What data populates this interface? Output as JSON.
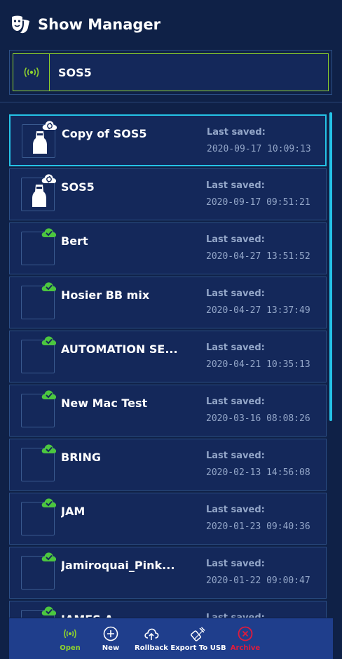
{
  "header": {
    "title": "Show Manager",
    "icon": "masks-icon"
  },
  "current_show": {
    "name": "SOS5",
    "icon": "signal-icon"
  },
  "shows": [
    {
      "name": "Copy of SOS5",
      "saved_label": "Last saved:",
      "saved_date": "2020-09-17 10:09:13",
      "thumb": "bag",
      "badge": "cloud-sync",
      "selected": true
    },
    {
      "name": "SOS5",
      "saved_label": "Last saved:",
      "saved_date": "2020-09-17 09:51:21",
      "thumb": "bag",
      "badge": "cloud-sync",
      "selected": false
    },
    {
      "name": "Bert",
      "saved_label": "Last saved:",
      "saved_date": "2020-04-27 13:51:52",
      "thumb": "empty",
      "badge": "cloud-check",
      "selected": false
    },
    {
      "name": "Hosier BB mix",
      "saved_label": "Last saved:",
      "saved_date": "2020-04-27 13:37:49",
      "thumb": "empty",
      "badge": "cloud-check",
      "selected": false
    },
    {
      "name": "AUTOMATION SE...",
      "saved_label": "Last saved:",
      "saved_date": "2020-04-21 10:35:13",
      "thumb": "empty",
      "badge": "cloud-check",
      "selected": false
    },
    {
      "name": "New Mac Test",
      "saved_label": "Last saved:",
      "saved_date": "2020-03-16 08:08:26",
      "thumb": "empty",
      "badge": "cloud-check",
      "selected": false
    },
    {
      "name": "BRING",
      "saved_label": "Last saved:",
      "saved_date": "2020-02-13 14:56:08",
      "thumb": "empty",
      "badge": "cloud-check",
      "selected": false
    },
    {
      "name": "JAM",
      "saved_label": "Last saved:",
      "saved_date": "2020-01-23 09:40:36",
      "thumb": "empty",
      "badge": "cloud-check",
      "selected": false
    },
    {
      "name": "Jamiroquai_Pink...",
      "saved_label": "Last saved:",
      "saved_date": "2020-01-22 09:00:47",
      "thumb": "empty",
      "badge": "cloud-check",
      "selected": false
    },
    {
      "name": "JAMES A...",
      "saved_label": "Last saved:",
      "saved_date": "",
      "thumb": "empty",
      "badge": "cloud-check",
      "selected": false
    }
  ],
  "toolbar": {
    "open": "Open",
    "new": "New",
    "rollback": "Rollback",
    "export": "Export To USB",
    "archive": "Archive"
  },
  "colors": {
    "background": "#0f2147",
    "card": "#14285a",
    "card_border": "#2c4f86",
    "selected_border": "#25c3e6",
    "accent_green": "#8ed12e",
    "archive_red": "#e01b3c",
    "toolbar": "#1f3e8c",
    "muted_text": "#93a6c8"
  }
}
